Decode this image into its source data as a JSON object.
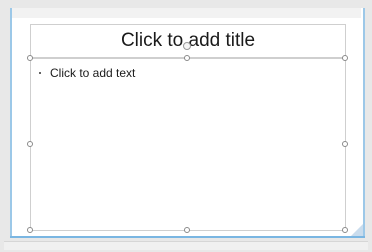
{
  "slide": {
    "title_placeholder": "Click to add title",
    "body_placeholder": "Click to add text"
  },
  "colors": {
    "selection_accent": "#7ab6e2",
    "placeholder_border": "#cfcfcf",
    "text": "#1a1a1a"
  }
}
